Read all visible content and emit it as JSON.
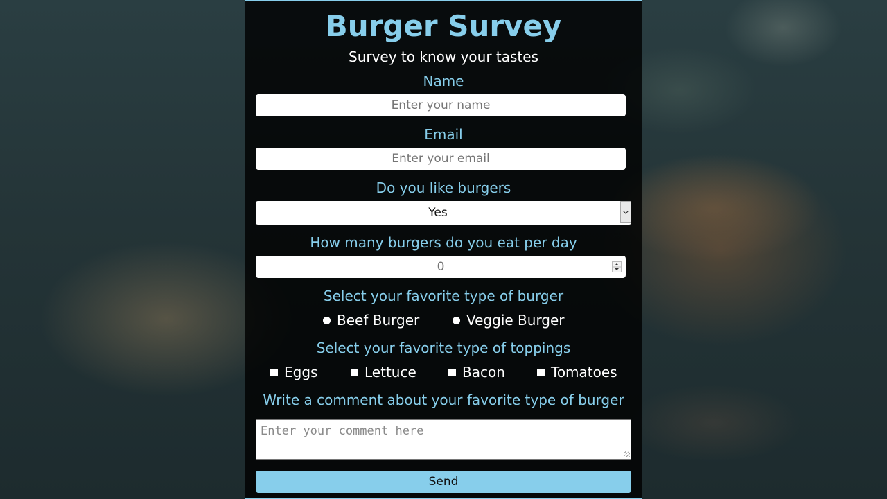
{
  "header": {
    "title": "Burger Survey",
    "subtitle": "Survey to know your tastes"
  },
  "form": {
    "name": {
      "label": "Name",
      "placeholder": "Enter your name"
    },
    "email": {
      "label": "Email",
      "placeholder": "Enter your email"
    },
    "likes": {
      "label": "Do you like burgers",
      "selected": "Yes"
    },
    "count": {
      "label": "How many burgers do you eat per day",
      "value": "0"
    },
    "burger_type": {
      "label": "Select your favorite type of burger",
      "options": [
        "Beef Burger",
        "Veggie Burger"
      ]
    },
    "toppings": {
      "label": "Select your favorite type of toppings",
      "options": [
        "Eggs",
        "Lettuce",
        "Bacon",
        "Tomatoes"
      ]
    },
    "comment": {
      "label": "Write a comment about your favorite type of burger",
      "placeholder": "Enter your comment here"
    },
    "submit_label": "Send"
  },
  "colors": {
    "accent": "#87ceeb",
    "panel_bg": "#000000",
    "text": "#ffffff"
  },
  "icons": {
    "select": "chevron-down-icon",
    "number": "spinner-icon"
  }
}
